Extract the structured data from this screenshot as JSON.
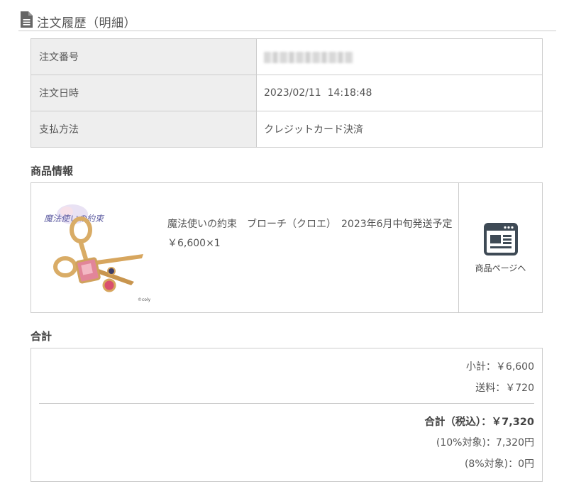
{
  "header": {
    "title": "注文履歴（明細）",
    "icon": "document-icon"
  },
  "order": {
    "rows": [
      {
        "label": "注文番号",
        "value": ""
      },
      {
        "label": "注文日時",
        "value": "2023/02/11  14:18:48"
      },
      {
        "label": "支払方法",
        "value": "クレジットカード決済"
      }
    ]
  },
  "product_section": {
    "label": "商品情報",
    "item": {
      "logo_text": "魔法使いの約束",
      "copyright": "©coly",
      "name": "魔法使いの約束　ブローチ（クロエ）　2023年6月中旬発送予定",
      "price_qty": "￥6,600×1"
    },
    "link_label": "商品ページへ",
    "link_icon": "browser-page-icon"
  },
  "totals": {
    "label": "合計",
    "subtotal": "小計：￥6,600",
    "shipping": "送料：￥720",
    "total": "合計（税込）：￥7,320",
    "tax10": "(10%対象)：7,320円",
    "tax8": "(8%対象)：0円"
  },
  "colors": {
    "border": "#cccccc",
    "header_cell_bg": "#eeeeee",
    "text": "#555555"
  }
}
